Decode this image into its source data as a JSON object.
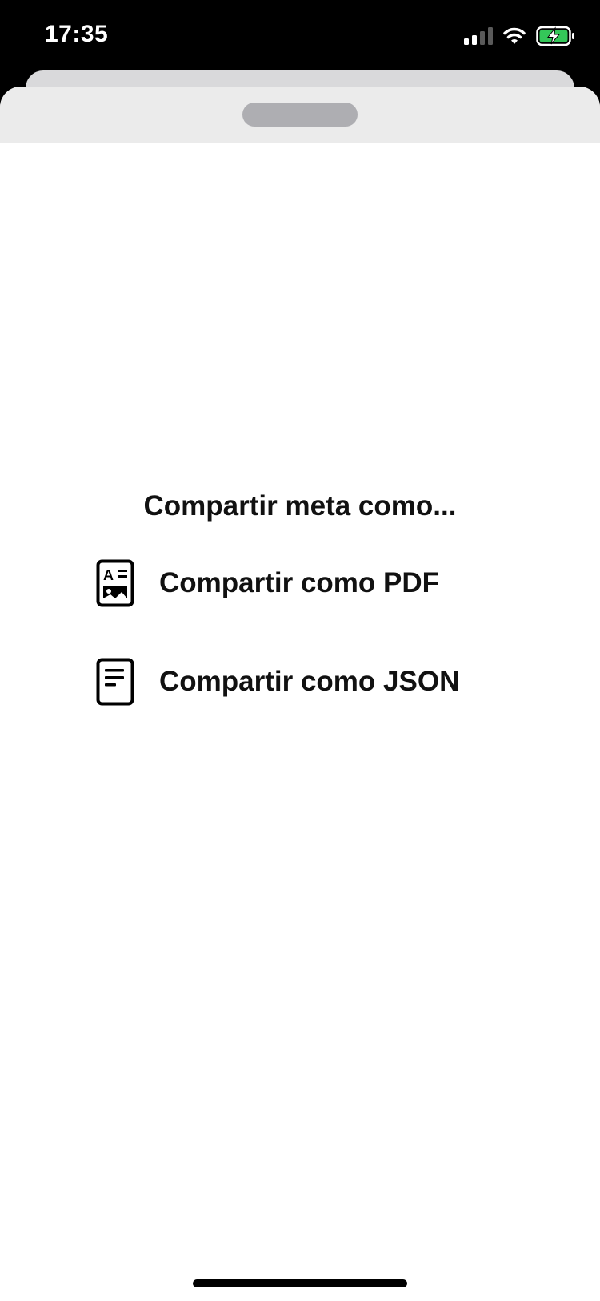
{
  "status_bar": {
    "time": "17:35",
    "signal_icon": "cellular-signal-icon",
    "wifi_icon": "wifi-icon",
    "battery_icon": "battery-charging-icon",
    "battery_color": "#34c759"
  },
  "sheet": {
    "grabber_icon": "sheet-grabber"
  },
  "share": {
    "title": "Compartir meta como...",
    "options": [
      {
        "label": "Compartir como PDF",
        "icon": "document-image-icon"
      },
      {
        "label": "Compartir como JSON",
        "icon": "document-text-icon"
      }
    ]
  }
}
